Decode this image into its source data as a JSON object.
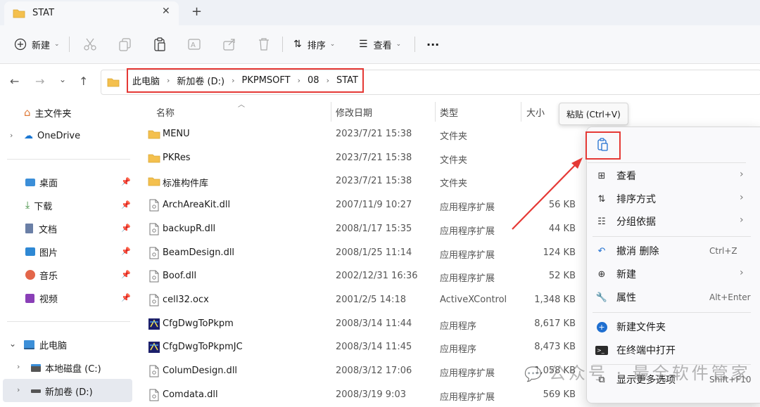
{
  "window": {
    "tab_title": "STAT",
    "close_glyph": "✕",
    "newtab_glyph": "+"
  },
  "toolbar": {
    "new_label": "新建",
    "sort_label": "排序",
    "view_label": "查看",
    "more_label": "···"
  },
  "address": {
    "crumbs": [
      "此电脑",
      "新加卷 (D:)",
      "PKPMSOFT",
      "08",
      "STAT"
    ]
  },
  "sidebar": {
    "home": "主文件夹",
    "onedrive": "OneDrive",
    "desktop": "桌面",
    "downloads": "下载",
    "documents": "文档",
    "pictures": "图片",
    "music": "音乐",
    "videos": "视频",
    "thispc": "此电脑",
    "disk_c": "本地磁盘 (C:)",
    "disk_d": "新加卷 (D:)"
  },
  "columns": {
    "name": "名称",
    "date": "修改日期",
    "type": "类型",
    "size": "大小"
  },
  "files": [
    {
      "name": "MENU",
      "date": "2023/7/21 15:38",
      "type": "文件夹",
      "size": ""
    },
    {
      "name": "PKRes",
      "date": "2023/7/21 15:38",
      "type": "文件夹",
      "size": ""
    },
    {
      "name": "标准构件库",
      "date": "2023/7/21 15:38",
      "type": "文件夹",
      "size": ""
    },
    {
      "name": "ArchAreaKit.dll",
      "date": "2007/11/9 10:27",
      "type": "应用程序扩展",
      "size": "56 KB"
    },
    {
      "name": "backupR.dll",
      "date": "2008/1/17 15:35",
      "type": "应用程序扩展",
      "size": "44 KB"
    },
    {
      "name": "BeamDesign.dll",
      "date": "2008/1/25 11:14",
      "type": "应用程序扩展",
      "size": "124 KB"
    },
    {
      "name": "Boof.dll",
      "date": "2002/12/31 16:36",
      "type": "应用程序扩展",
      "size": "52 KB"
    },
    {
      "name": "cell32.ocx",
      "date": "2001/2/5 14:18",
      "type": "ActiveXControl",
      "size": "1,348 KB"
    },
    {
      "name": "CfgDwgToPkpm",
      "date": "2008/3/14 11:44",
      "type": "应用程序",
      "size": "8,617 KB"
    },
    {
      "name": "CfgDwgToPkpmJC",
      "date": "2008/3/14 11:45",
      "type": "应用程序",
      "size": "8,473 KB"
    },
    {
      "name": "ColumDesign.dll",
      "date": "2008/3/12 17:06",
      "type": "应用程序扩展",
      "size": "1,058 KB"
    },
    {
      "name": "Comdata.dll",
      "date": "2008/3/19 9:03",
      "type": "应用程序扩展",
      "size": "569 KB"
    }
  ],
  "tooltip": "粘贴 (Ctrl+V)",
  "context_menu": {
    "view": "查看",
    "sort": "排序方式",
    "group": "分组依据",
    "undo": "撤消 删除",
    "undo_sc": "Ctrl+Z",
    "new": "新建",
    "props": "属性",
    "props_sc": "Alt+Enter",
    "new_folder": "新建文件夹",
    "terminal": "在终端中打开",
    "more": "显示更多选项",
    "more_sc": "Shift+F10"
  },
  "watermark": "公众号 · 最全软件管家",
  "colors": {
    "accent": "#e53935",
    "folder": "#f4c04e",
    "selected": "#e6e9ef"
  }
}
